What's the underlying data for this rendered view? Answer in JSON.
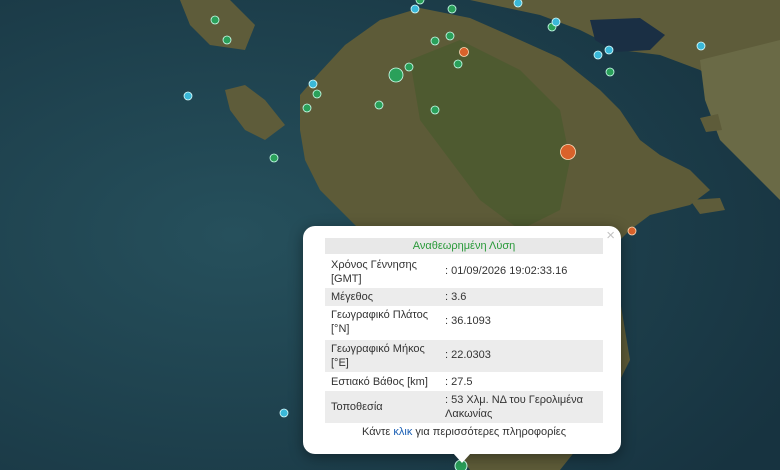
{
  "map": {
    "colors": {
      "sea": "#1c3c48",
      "land": "#5b5a36",
      "mountain": "#4a5a2c",
      "marker_green": "#2aa05a",
      "marker_cyan": "#3ab8d8",
      "marker_orange": "#d9622b"
    }
  },
  "popup": {
    "header": "Αναθεωρημένη Λύση",
    "close_icon": "close-icon",
    "rows": [
      {
        "label": "Χρόνος Γέννησης [GMT]",
        "value": ": 01/09/2026 19:02:33.16"
      },
      {
        "label": "Μέγεθος",
        "value": ": 3.6"
      },
      {
        "label": "Γεωγραφικό Πλάτος [°N]",
        "value": ": 36.1093"
      },
      {
        "label": "Γεωγραφικό Μήκος [°E]",
        "value": ": 22.0303"
      },
      {
        "label": "Εστιακό Βάθος [km]",
        "value": ": 27.5"
      },
      {
        "label": "Τοποθεσία",
        "value": ": 53 Χλμ. ΝΔ του Γερολιμένα Λακωνίας"
      }
    ],
    "footer_prefix": "Κάντε",
    "footer_link": "κλικ",
    "footer_suffix": "για περισσότερες πληροφορίες"
  }
}
